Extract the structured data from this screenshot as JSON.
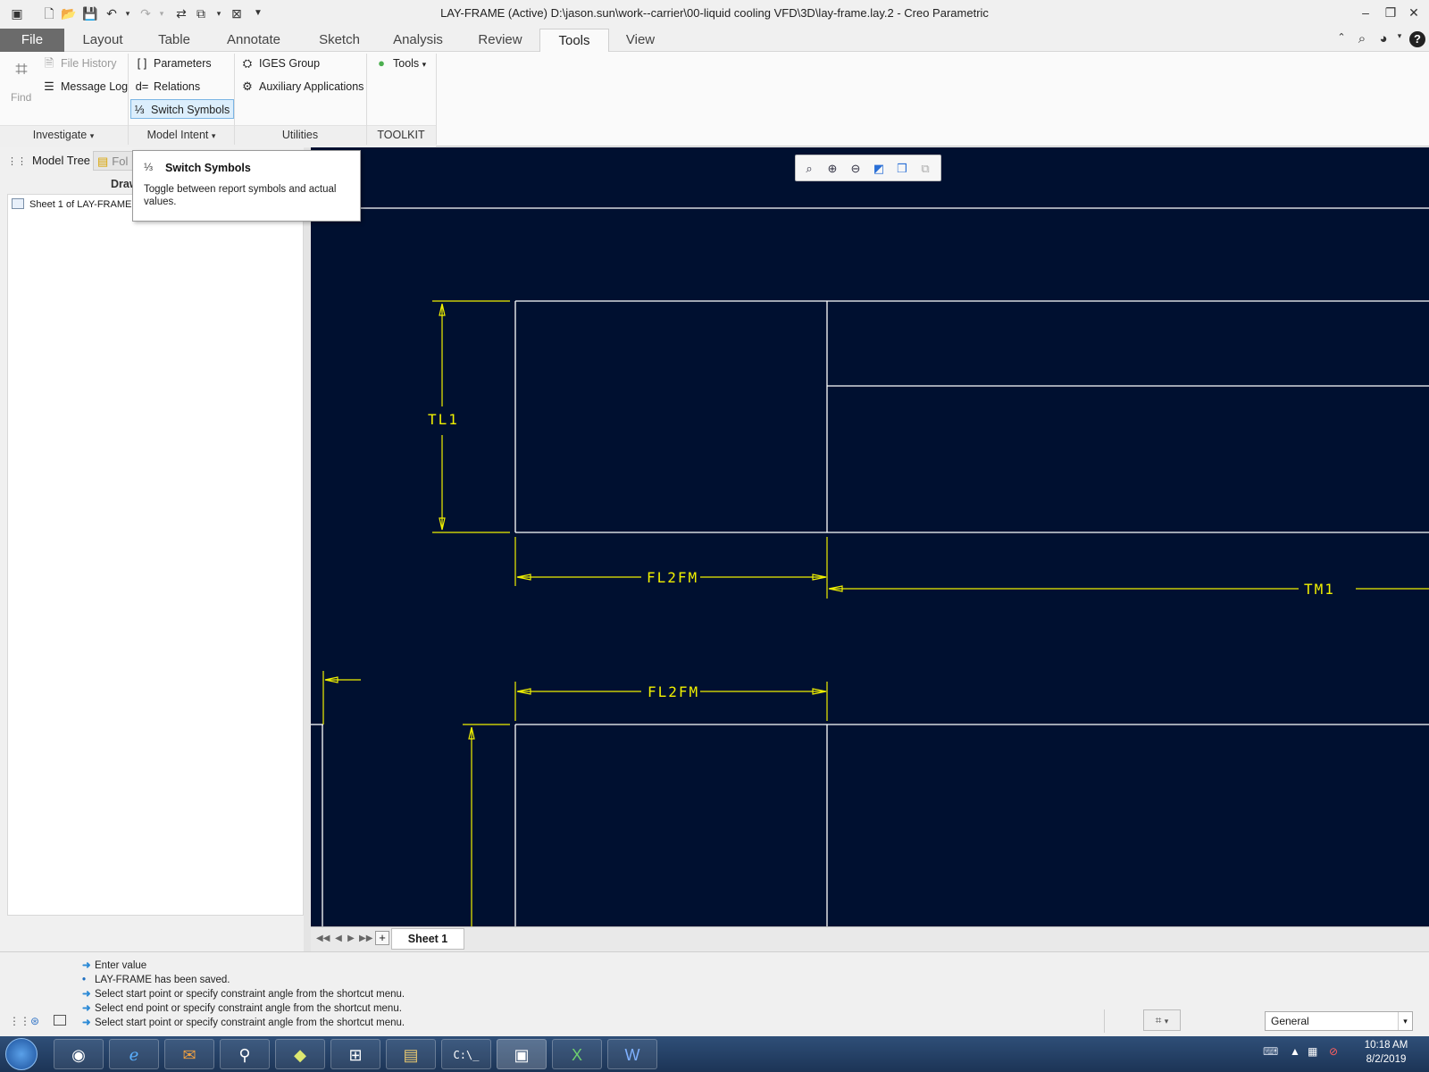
{
  "window": {
    "title": "LAY-FRAME (Active) D:\\jason.sun\\work--carrier\\00-liquid cooling VFD\\3D\\lay-frame.lay.2 - Creo Parametric"
  },
  "ribbon_tabs": [
    "File",
    "Layout",
    "Table",
    "Annotate",
    "Sketch",
    "Analysis",
    "Review",
    "Tools",
    "View"
  ],
  "active_tab": "Tools",
  "ribbon": {
    "find_label": "Find",
    "file_history": "File History",
    "message_log": "Message Log",
    "parameters": "Parameters",
    "relations": "Relations",
    "switch_symbols": "Switch Symbols",
    "iges_group": "IGES Group",
    "auxiliary_applications": "Auxiliary Applications",
    "tools": "Tools",
    "groups": {
      "investigate": "Investigate",
      "model_intent": "Model Intent",
      "utilities": "Utilities",
      "toolkit": "TOOLKIT"
    }
  },
  "left_panel": {
    "tab_model_tree": "Model Tree",
    "tab_folder_partial": "Fol",
    "header_partial": "Draw",
    "tree_item": "Sheet 1 of LAY-FRAME."
  },
  "tooltip": {
    "title": "Switch Symbols",
    "body": "Toggle between report symbols and actual values."
  },
  "drawing": {
    "dimensions": [
      "TL1",
      "FL2FM",
      "TM1",
      "FL2FM"
    ],
    "background": "#001030",
    "geometry_color": "#ffffff",
    "dimension_color": "#f0f000"
  },
  "sheet_tabs": {
    "add": "+",
    "sheet": "Sheet 1"
  },
  "messages": [
    {
      "icon": "arrow",
      "text": "Enter value"
    },
    {
      "icon": "bullet",
      "text": "LAY-FRAME has been saved."
    },
    {
      "icon": "arrow",
      "text": "Select start point or specify constraint angle from the shortcut menu."
    },
    {
      "icon": "arrow",
      "text": "Select end point or specify constraint angle from the shortcut menu."
    },
    {
      "icon": "arrow",
      "text": "Select start point or specify constraint angle from the shortcut menu."
    }
  ],
  "status": {
    "filter": "General"
  },
  "taskbar": {
    "time": "10:18 AM",
    "date": "8/2/2019"
  }
}
